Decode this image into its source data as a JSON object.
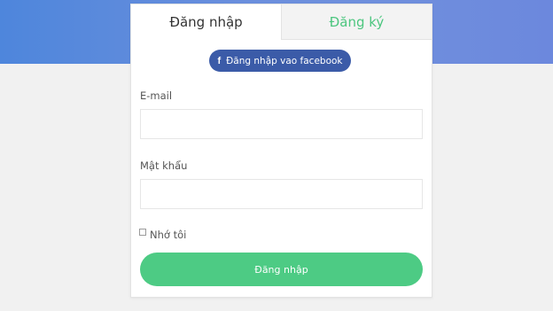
{
  "tabs": {
    "login_label": "Đăng nhập",
    "register_label": "Đăng ký"
  },
  "facebook_button": {
    "icon_glyph": "f",
    "label": "Đăng nhập vao facebook"
  },
  "form": {
    "email_label": "E-mail",
    "email_value": "",
    "password_label": "Mật khẩu",
    "password_value": "",
    "remember_label": "Nhớ tôi",
    "remember_checked": false,
    "submit_label": "Đăng nhập"
  },
  "colors": {
    "header_blue": "#5b86dc",
    "facebook_blue": "#3b5ba8",
    "accent_green": "#4dcb84",
    "background": "#f1f1f1"
  }
}
